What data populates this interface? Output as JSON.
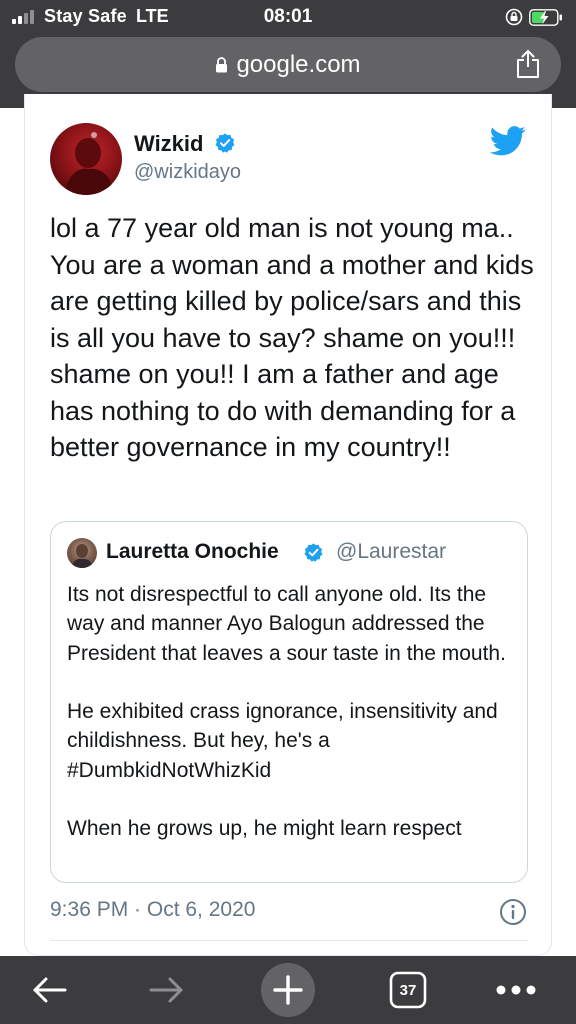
{
  "status_bar": {
    "carrier": "Stay Safe",
    "network": "LTE",
    "time": "08:01"
  },
  "browser": {
    "url": "google.com",
    "tabs_count": "37"
  },
  "tweet": {
    "author_name": "Wizkid",
    "author_handle": "@wizkidayo",
    "text": "lol a 77 year old man is not young ma.. You are a woman and a mother and kids are getting killed by police/sars and this is all you have to say? shame on you!!! shame on you!! I am a father and age has nothing to do with demanding for a better governance in my country!!",
    "timestamp": "9:36 PM · Oct 6, 2020",
    "quoted": {
      "author_name": "Lauretta Onochie",
      "author_handle": "@Laurestar",
      "paragraphs": [
        "Its not disrespectful to call anyone old. Its the way and manner Ayo Balogun addressed the President that leaves a sour taste in the mouth.",
        "He exhibited crass ignorance, insensitivity and childishness. But hey, he's a #DumbkidNotWhizKid",
        "When he grows up, he might learn respect"
      ]
    }
  },
  "colors": {
    "chrome": "#3c3c3e",
    "url_pill": "#636366",
    "twitter_blue": "#1da1f2",
    "text": "#14171a",
    "muted": "#657786"
  },
  "icons": [
    "signal-icon",
    "rotation-lock-icon",
    "battery-charging-icon",
    "padlock-icon",
    "share-icon",
    "verified-badge-icon",
    "twitter-bird-icon",
    "info-icon",
    "back-arrow-icon",
    "forward-arrow-icon",
    "new-tab-plus-icon",
    "tabs-icon",
    "more-icon"
  ]
}
